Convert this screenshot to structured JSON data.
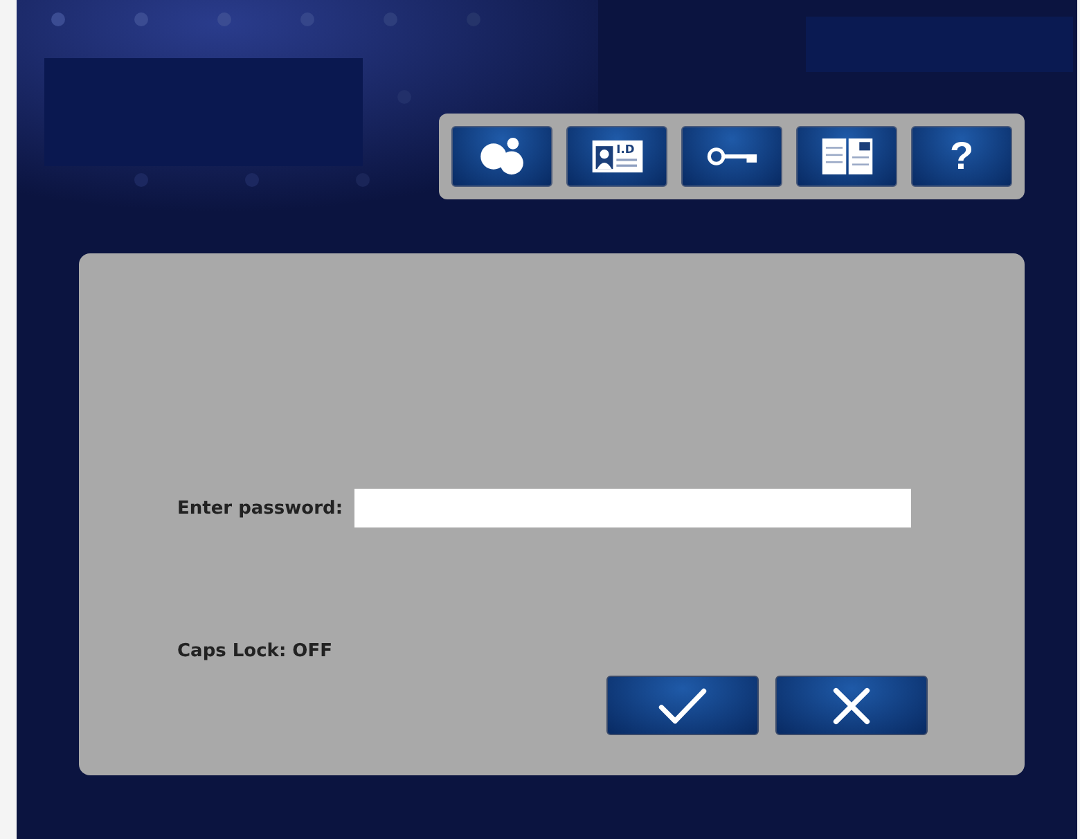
{
  "toolbar": [
    {
      "kind": "chat"
    },
    {
      "kind": "id-card",
      "label": "I.D"
    },
    {
      "kind": "key"
    },
    {
      "kind": "book"
    },
    {
      "kind": "text",
      "label": "?"
    }
  ],
  "dialog": {
    "password_label": "Enter password:",
    "caps_lock": "Caps Lock: OFF",
    "buttons": [
      {
        "kind": "confirm"
      },
      {
        "kind": "cancel"
      }
    ]
  }
}
